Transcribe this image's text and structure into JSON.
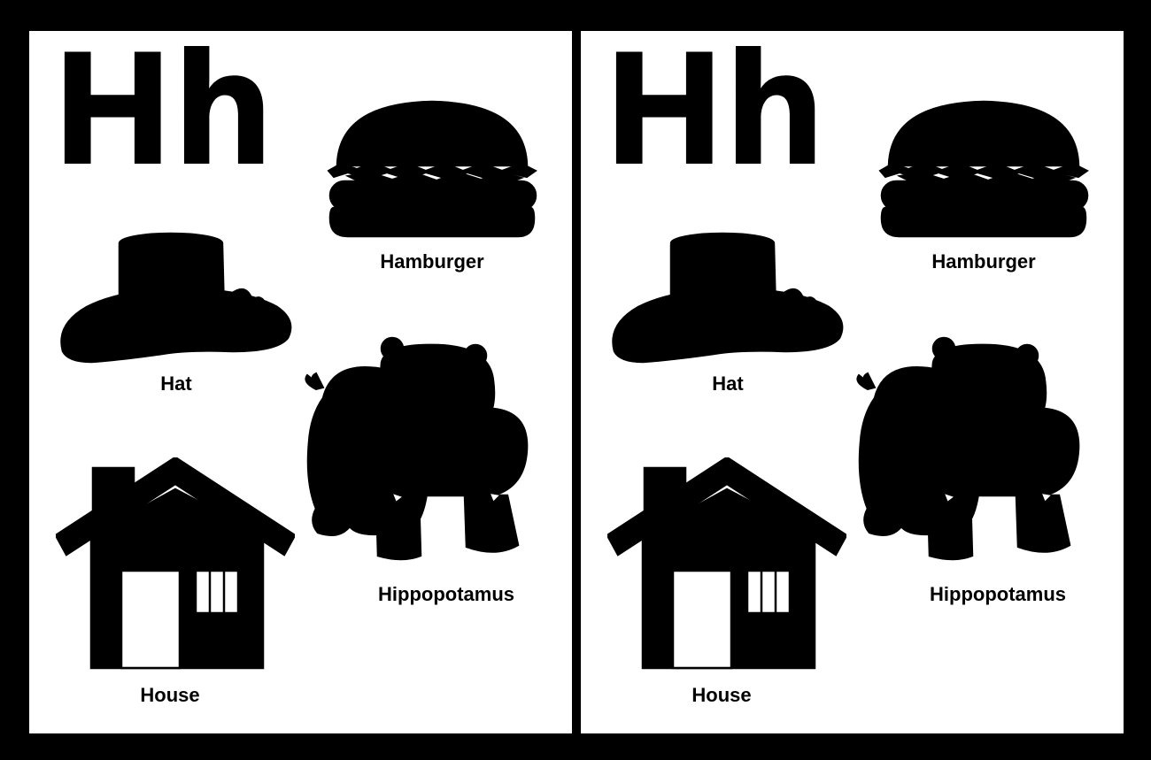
{
  "letter": "Hh",
  "words": {
    "hamburger": "Hamburger",
    "hat": "Hat",
    "hippopotamus": "Hippopotamus",
    "house": "House"
  },
  "colors": {
    "background": "#000000",
    "page": "#ffffff",
    "bun": "#f9c79c",
    "lettuce": "#47c04a",
    "tomato": "#e03a2a",
    "cheese": "#ffc107",
    "patty": "#c8643a",
    "hat_brim": "#55c83c",
    "hat_crown": "#39c4f0",
    "hat_band": "#f7c20e",
    "hippo": "#a8c8f8",
    "house_wall": "#ff6ed0",
    "roof": "#ffc700",
    "chimney": "#b95b1a"
  }
}
